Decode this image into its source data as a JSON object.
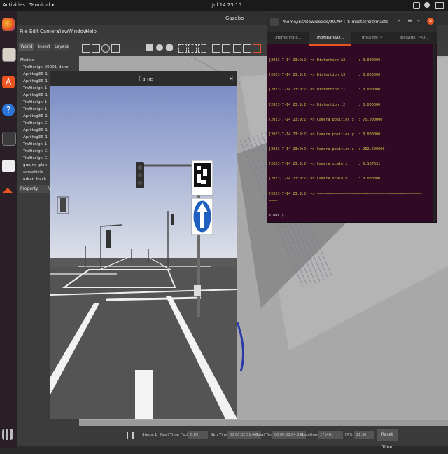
{
  "topbar": {
    "activities": "Activities",
    "app_menu": "Terminal ▾",
    "clock": "Jul 14  23:10"
  },
  "gazebo": {
    "title": "Gazebo",
    "menu": [
      "File",
      "Edit",
      "Camera",
      "View",
      "Window",
      "Help"
    ],
    "panel_tabs": [
      "World",
      "Insert",
      "Layers"
    ],
    "tree_root": "Models",
    "tree_items": [
      "Trafficsign_00001_done",
      "Apriltag36_1",
      "Apriltag36_1",
      "Trafficsign_1",
      "Apriltag36_1",
      "Trafficsign_1",
      "Trafficsign_1",
      "Apriltag36_1",
      "Trafficsign_C",
      "Apriltag36_1",
      "Apriltag36_1",
      "Trafficsign_1",
      "Trafficsign_C",
      "Trafficsign_C",
      "ground_plan",
      "carvehicle",
      "urban_track"
    ],
    "property_header": "Property",
    "property_value": "V",
    "status": {
      "steps_label": "Steps:",
      "steps_value": "1",
      "rtf_label": "Real Time Factor:",
      "rtf_value": "0.85",
      "simtime_label": "Sim Time:",
      "simtime_value": "00 00:02:51.461",
      "realtime_label": "Real Time:",
      "realtime_value": "00 00:03:04.833",
      "iterations_label": "Iterations:",
      "iterations_value": "171461",
      "fps_label": "FPS:",
      "fps_value": "21.36",
      "reset_button": "Reset Time"
    }
  },
  "frame_window": {
    "title": "frame"
  },
  "terminal": {
    "title": "/home/iris/Downloads/IRCAR-ITS-master/src/master/(launc...",
    "tabs": [
      "/home/iris/c...",
      "/home/iris/D...",
      "iris@iris: ~",
      "iris@iris: ~/D..."
    ],
    "lines": [
      "[2023-7-14 23:9:2] => Distortion k2      : 0.000000",
      "[2023-7-14 23:9:2] => Distortion k3      : 0.000000",
      "[2023-7-14 23:9:2] => Distortion t1      : 0.000000",
      "[2023-7-14 23:9:2] => Distortion t2      : 0.000000",
      "[2023-7-14 23:9:2] => Camera position x  : 75.000000",
      "[2023-7-14 23:9:2] => Camera position y  : 0.000000",
      "[2023-7-14 23:9:2] => Camera position z  : 202.500000",
      "[2023-7-14 23:9:2] => Camera scale x     : 0.157331",
      "[2023-7-14 23:9:2] => Camera scale y     : 0.000000",
      "[2023-7-14 23:9:2] => ================================================",
      "===="
    ],
    "prompt": "s was ▯"
  },
  "colors": {
    "terminal_bg": "#300a24",
    "terminal_text": "#c8c84a",
    "sky_top": "#7d8fc4",
    "sky_bottom": "#d8dbe6",
    "sign_blue": "#1f5fc0",
    "orange_accent": "#e95420"
  }
}
